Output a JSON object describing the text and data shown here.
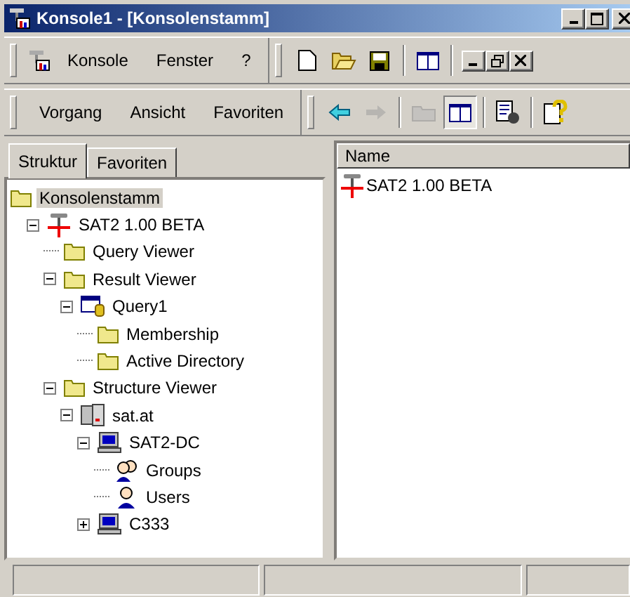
{
  "window": {
    "title": "Konsole1 - [Konsolenstamm]"
  },
  "menu_bar": {
    "items": [
      "Konsole",
      "Fenster",
      "?"
    ],
    "toolbar": [
      {
        "kind": "new",
        "disabled": false
      },
      {
        "kind": "open",
        "disabled": false
      },
      {
        "kind": "save",
        "disabled": false
      },
      {
        "kind": "split",
        "disabled": false
      }
    ]
  },
  "action_bar": {
    "items": [
      "Vorgang",
      "Ansicht",
      "Favoriten"
    ],
    "toolbar": [
      {
        "kind": "back",
        "disabled": false,
        "pressed": false
      },
      {
        "kind": "forward",
        "disabled": true,
        "pressed": false
      },
      {
        "kind": "up",
        "disabled": true,
        "pressed": false
      },
      {
        "kind": "tree",
        "disabled": false,
        "pressed": true
      },
      {
        "kind": "export",
        "disabled": false,
        "pressed": false
      },
      {
        "kind": "help",
        "disabled": false,
        "pressed": false
      }
    ]
  },
  "tabs": [
    {
      "label": "Struktur",
      "selected": true
    },
    {
      "label": "Favoriten",
      "selected": false
    }
  ],
  "tree": [
    {
      "label": "Konsolenstamm",
      "kind": "folder",
      "selected": true,
      "children": [
        {
          "label": "SAT2 1.00 BETA",
          "kind": "sat",
          "selected": false,
          "expanded": true,
          "children": [
            {
              "label": "Query Viewer",
              "kind": "folder",
              "selected": false
            },
            {
              "label": "Result Viewer",
              "kind": "folder",
              "selected": false,
              "expanded": true,
              "children": [
                {
                  "label": "Query1",
                  "kind": "query",
                  "selected": false,
                  "expanded": true,
                  "children": [
                    {
                      "label": "Membership",
                      "kind": "folder",
                      "selected": false
                    },
                    {
                      "label": "Active Directory",
                      "kind": "folder",
                      "selected": false
                    }
                  ]
                }
              ]
            },
            {
              "label": "Structure Viewer",
              "kind": "folder",
              "selected": false,
              "expanded": true,
              "children": [
                {
                  "label": "sat.at",
                  "kind": "server",
                  "selected": false,
                  "expanded": true,
                  "children": [
                    {
                      "label": "SAT2-DC",
                      "kind": "computer",
                      "selected": false,
                      "expanded": true,
                      "children": [
                        {
                          "label": "Groups",
                          "kind": "users",
                          "selected": false
                        },
                        {
                          "label": "Users",
                          "kind": "user",
                          "selected": false
                        }
                      ]
                    },
                    {
                      "label": "C333",
                      "kind": "computer",
                      "selected": false,
                      "expanded": false
                    }
                  ]
                }
              ]
            }
          ]
        }
      ]
    }
  ],
  "list": {
    "columns": [
      "Name"
    ],
    "rows": [
      {
        "label": "SAT2 1.00 BETA",
        "kind": "sat"
      }
    ]
  }
}
